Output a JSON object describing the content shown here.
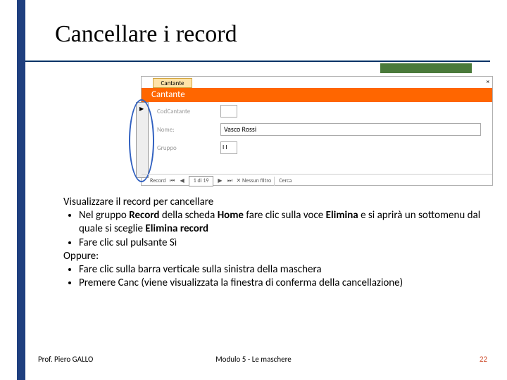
{
  "title": "Cancellare i record",
  "screenshot": {
    "tab_label": "Cantante",
    "close_glyph": "×",
    "form_title": "Cantante",
    "selector_arrow": "▶",
    "fields": {
      "cod_label": "CodCantante",
      "cod_value": "",
      "nome_label": "Nome:",
      "nome_value": "Vasco Rossi",
      "gruppo_label": "Gruppo",
      "gruppo_value": "I I"
    },
    "nav": {
      "record_label": "Record",
      "first": "⏮",
      "prev": "◀",
      "pos": "1 di 19",
      "next": "▶",
      "last": "⏭",
      "filter": "✕ Nessun filtro",
      "search_label": "Cerca"
    }
  },
  "body": {
    "intro": "Visualizzare il record per cancellare",
    "b1_pre": "Nel gruppo ",
    "b1_bold1": "Record",
    "b1_mid1": " della scheda ",
    "b1_bold2": "Home",
    "b1_mid2": " fare clic sulla voce ",
    "b1_bold3": "Elimina",
    "b1_mid3": " e si aprirà un sottomenu dal quale si sceglie ",
    "b1_bold4": "Elimina record",
    "b2": "Fare clic sul pulsante Sì",
    "oppure": "Oppure:",
    "b3": "Fare clic sulla barra verticale sulla sinistra della maschera",
    "b4": "Premere Canc (viene visualizzata la finestra di conferma della cancellazione)"
  },
  "footer": {
    "left": "Prof. Piero GALLO",
    "center": "Modulo 5  -  Le maschere",
    "right": "22"
  }
}
